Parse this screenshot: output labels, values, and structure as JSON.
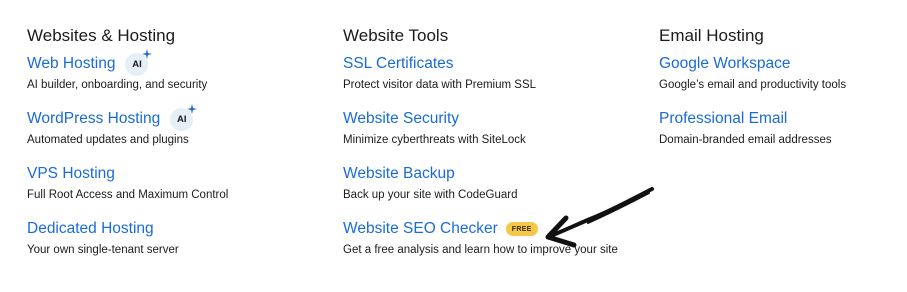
{
  "columns": [
    {
      "title": "Websites & Hosting",
      "items": [
        {
          "label": "Web Hosting",
          "badge": "AI",
          "description": "AI builder, onboarding, and security"
        },
        {
          "label": "WordPress Hosting",
          "badge": "AI",
          "description": "Automated updates and plugins"
        },
        {
          "label": "VPS Hosting",
          "description": "Full Root Access and Maximum Control"
        },
        {
          "label": "Dedicated Hosting",
          "description": "Your own single-tenant server"
        }
      ]
    },
    {
      "title": "Website Tools",
      "items": [
        {
          "label": "SSL Certificates",
          "description": "Protect visitor data with Premium SSL"
        },
        {
          "label": "Website Security",
          "description": "Minimize cyberthreats with SiteLock"
        },
        {
          "label": "Website Backup",
          "description": "Back up your site with CodeGuard"
        },
        {
          "label": "Website SEO Checker",
          "badge": "FREE",
          "description": "Get a free analysis and learn how to improve your site"
        }
      ]
    },
    {
      "title": "Email Hosting",
      "items": [
        {
          "label": "Google Workspace",
          "description": "Google’s email and productivity tools"
        },
        {
          "label": "Professional Email",
          "description": "Domain-branded email addresses"
        }
      ]
    }
  ],
  "colors": {
    "link": "#1a6bd6",
    "text": "#1b1b1b",
    "ai_badge_bg": "#e6eef8",
    "free_badge_bg": "#f6c84a"
  }
}
